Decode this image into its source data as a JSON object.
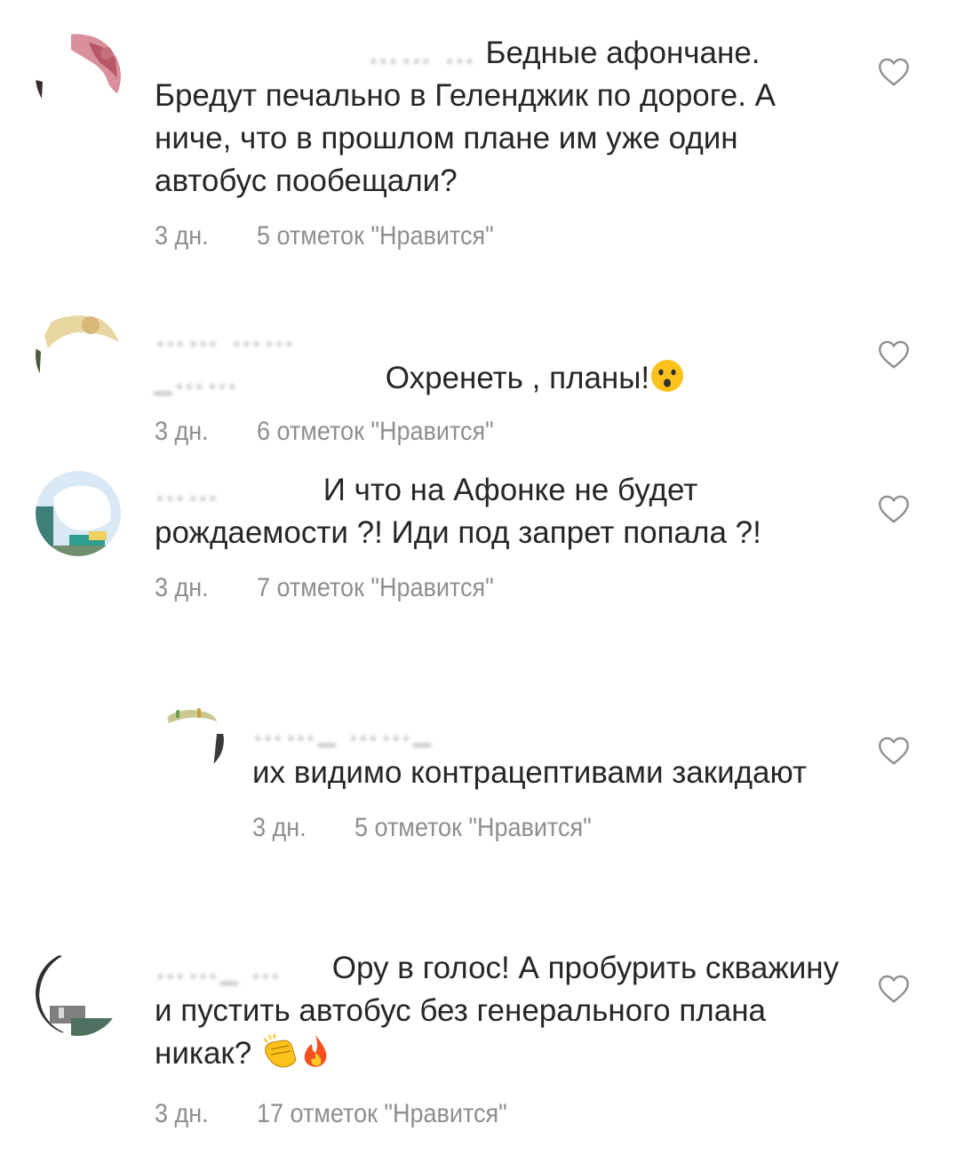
{
  "comments": [
    {
      "username": "…… …",
      "text": "Бедные афончане. Бредут печально в Геленджик по дороге. А ниче, что в прошлом плане им уже один автобус пообещали?",
      "time": "3 дн.",
      "likes": "5 отметок \"Нравится\""
    },
    {
      "username": "…… ……_……",
      "text": "Охренеть , планы!",
      "time": "3 дн.",
      "likes": "6 отметок \"Нравится\""
    },
    {
      "username": "……",
      "text": "И что на Афонке не будет рождаемости ?! Иди под запрет попала ?!",
      "time": "3 дн.",
      "likes": "7 отметок \"Нравится\""
    },
    {
      "username": "……_ ……_",
      "text": "их видимо контрацептивами закидают",
      "time": "3 дн.",
      "likes": "5 отметок \"Нравится\""
    },
    {
      "username": "……_ …",
      "text": "Ору в голос! А пробурить скважину и пустить автобус без генерального плана никак?",
      "time": "3 дн.",
      "likes": "17 отметок \"Нравится\""
    }
  ],
  "icons": {
    "like": "heart-outline-icon",
    "emoji_face": "hushed-face-emoji",
    "emoji_clap": "clapping-hands-emoji",
    "emoji_fire": "fire-emoji"
  },
  "colors": {
    "text": "#262626",
    "meta": "#8e8e8e",
    "heart": "#8e8e8e"
  }
}
